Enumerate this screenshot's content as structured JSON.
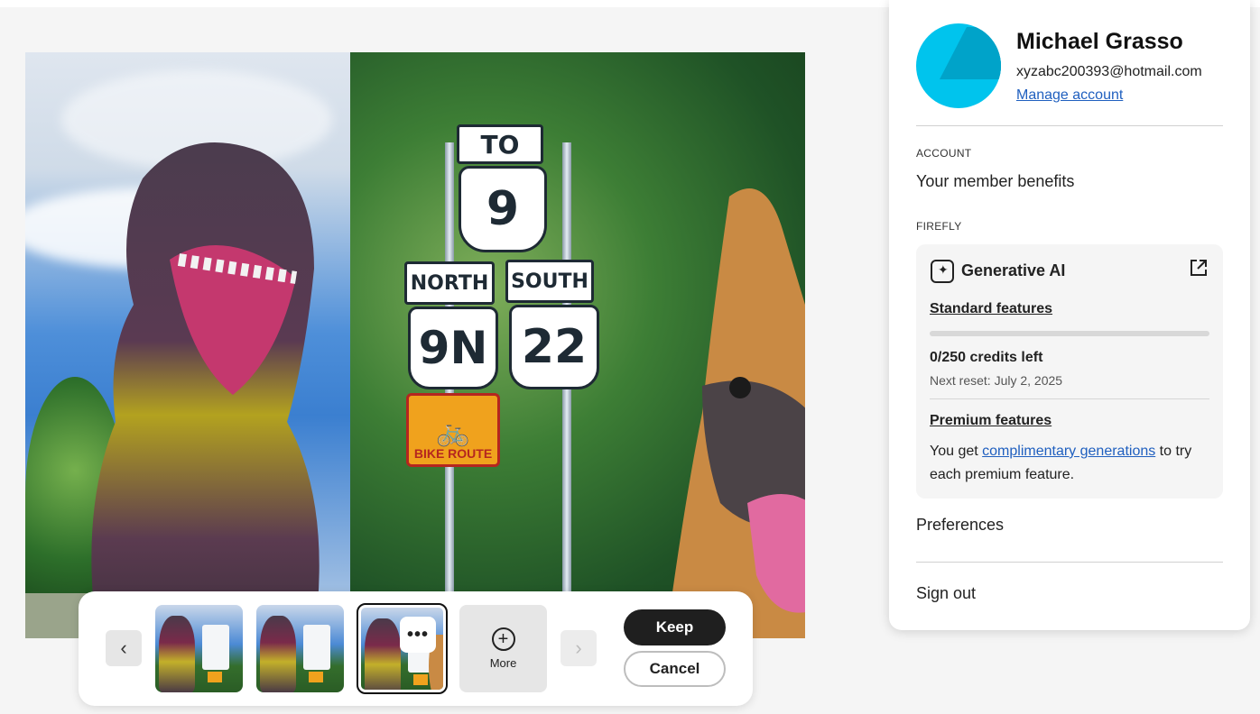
{
  "account_panel": {
    "user_name": "Michael Grasso",
    "email": "xyzabc200393@hotmail.com",
    "manage_account": "Manage account",
    "account_caption": "ACCOUNT",
    "member_benefits": "Your member benefits",
    "firefly_caption": "FIREFLY",
    "generative_ai": {
      "title": "Generative AI",
      "standard_features": "Standard features",
      "credits_used_fraction": 0,
      "credits_left": "0/250 credits left",
      "next_reset": "Next reset: July 2, 2025",
      "premium_features": "Premium features",
      "premium_text_before": "You get ",
      "premium_link": "complimentary generations",
      "premium_text_after": " to try each premium feature."
    },
    "preferences": "Preferences",
    "sign_out": "Sign out",
    "avatar_color": "#00c4ed"
  },
  "canvas": {
    "signs": {
      "to": "TO",
      "route_9": "9",
      "north": "NORTH",
      "south": "SOUTH",
      "route_9n": "9N",
      "route_22": "22",
      "bike_route": "BIKE ROUTE"
    }
  },
  "variations_toolbar": {
    "prev_icon": "chevron-left-icon",
    "next_icon": "chevron-right-icon",
    "options_glyph": "•••",
    "more_label": "More",
    "keep_label": "Keep",
    "cancel_label": "Cancel"
  }
}
